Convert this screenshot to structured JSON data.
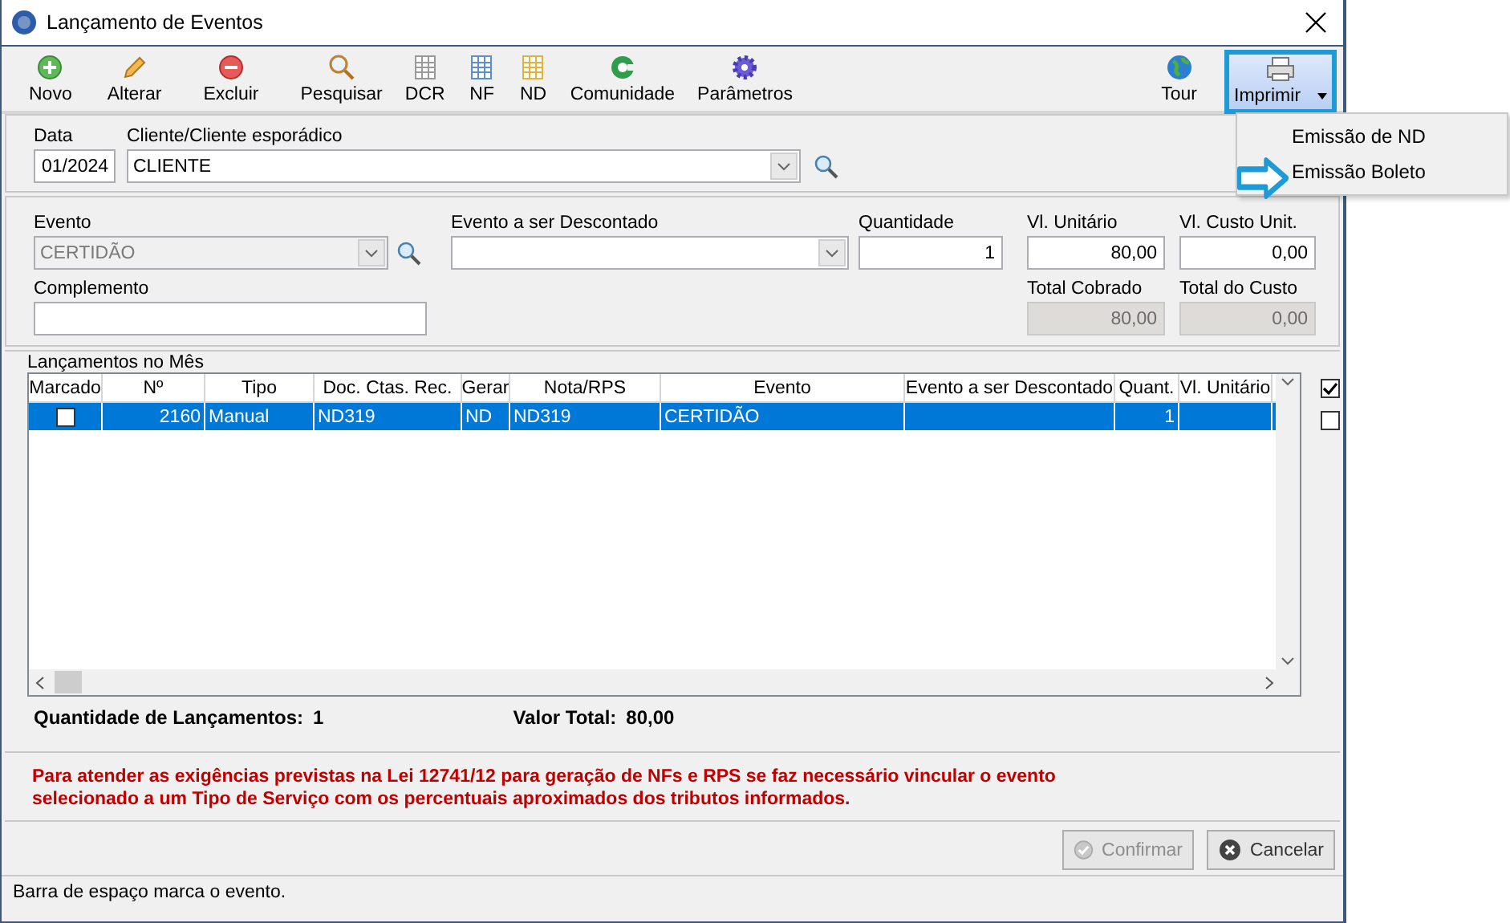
{
  "window": {
    "title": "Lançamento de Eventos"
  },
  "toolbar": [
    {
      "label": "Novo",
      "kind": "add"
    },
    {
      "label": "Alterar",
      "kind": "edit"
    },
    {
      "label": "Excluir",
      "kind": "delete"
    },
    {
      "label": "Pesquisar",
      "kind": "search"
    },
    {
      "label": "DCR",
      "kind": "sheet",
      "color": "#9a9a9a"
    },
    {
      "label": "NF",
      "kind": "sheet",
      "color": "#5b8fd0"
    },
    {
      "label": "ND",
      "kind": "sheet",
      "color": "#e0b43a"
    },
    {
      "label": "Comunidade",
      "kind": "community"
    },
    {
      "label": "Parâmetros",
      "kind": "settings"
    }
  ],
  "tour": {
    "label": "Tour"
  },
  "print": {
    "label": "Imprimir",
    "expanded": true,
    "items": [
      {
        "label": "Emissão de ND",
        "selected": false
      },
      {
        "label": "Emissão Boleto",
        "selected": true
      }
    ]
  },
  "header": {
    "date": {
      "label": "Data",
      "value": "01/2024"
    },
    "client": {
      "label": "Cliente/Cliente esporádico",
      "value": "CLIENTE"
    }
  },
  "event": {
    "event": {
      "label": "Evento",
      "value": "CERTIDÃO",
      "disabled": true
    },
    "discount": {
      "label": "Evento a ser Descontado",
      "disabled": false
    },
    "quantity": {
      "label": "Quantidade",
      "value": "1"
    },
    "unit_value": {
      "label": "Vl. Unitário",
      "value": "80,00"
    },
    "unit_cost": {
      "label": "Vl. Custo Unit.",
      "value": "0,00"
    },
    "complement": {
      "label": "Complemento"
    },
    "total_charged": {
      "label": "Total Cobrado",
      "value": "80,00"
    },
    "total_cost": {
      "label": "Total do Custo",
      "value": "0,00"
    }
  },
  "entries": {
    "title": "Lançamentos no Mês",
    "columns": [
      {
        "label": "Marcado"
      },
      {
        "label": "Nº"
      },
      {
        "label": "Tipo"
      },
      {
        "label": "Doc. Ctas. Rec."
      },
      {
        "label": "Gerar"
      },
      {
        "label": "Nota/RPS"
      },
      {
        "label": "Evento"
      },
      {
        "label": "Evento a ser Descontado"
      },
      {
        "label": "Quant."
      },
      {
        "label": "Vl. Unitário"
      }
    ],
    "rows": [
      {
        "selected": true,
        "marked": false,
        "cells": [
          "",
          "2160",
          "Manual",
          "ND319",
          "ND",
          "ND319",
          "CERTIDÃO",
          "",
          "1",
          ""
        ]
      }
    ],
    "side_checks": [
      {
        "checked": true
      },
      {
        "checked": false
      }
    ]
  },
  "totals": [
    {
      "label": "Quantidade de Lançamentos:",
      "value": "1"
    },
    {
      "label": "Valor Total:",
      "value": "80,00"
    }
  ],
  "warning": "Para atender as exigências previstas na Lei 12741/12 para geração de NFs e RPS se faz necessário vincular o evento selecionado a um Tipo de Serviço com os percentuais aproximados dos tributos informados.",
  "buttons": [
    {
      "label": "Confirmar",
      "kind": "confirm",
      "disabled": true
    },
    {
      "label": "Cancelar",
      "kind": "cancel",
      "disabled": false
    }
  ],
  "status_bar": "Barra de espaço marca o evento."
}
